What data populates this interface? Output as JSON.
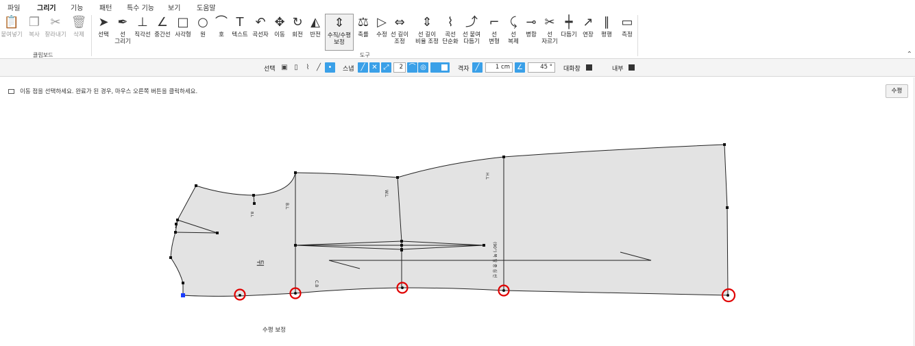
{
  "menu": {
    "items": [
      "파일",
      "그리기",
      "기능",
      "패턴",
      "특수 기능",
      "보기",
      "도움말"
    ]
  },
  "ribbon": {
    "clipboard": {
      "group_label": "클립보드",
      "buttons": [
        {
          "label": "붙여넣기",
          "icon": "paste-icon"
        },
        {
          "label": "복사",
          "icon": "copy-icon"
        },
        {
          "label": "잘라내기",
          "icon": "cut-icon"
        },
        {
          "label": "삭제",
          "icon": "delete-icon"
        }
      ]
    },
    "tools": {
      "group_label": "도구",
      "buttons": [
        {
          "label": "선택",
          "icon": "select-arrow-icon"
        },
        {
          "label": "선\n그리기",
          "icon": "pen-icon"
        },
        {
          "label": "직각선",
          "icon": "perpendicular-icon"
        },
        {
          "label": "중간선",
          "icon": "middle-line-icon"
        },
        {
          "label": "사각형",
          "icon": "rectangle-icon"
        },
        {
          "label": "원",
          "icon": "circle-icon"
        },
        {
          "label": "호",
          "icon": "arc-icon"
        },
        {
          "label": "텍스트",
          "icon": "text-icon"
        },
        {
          "label": "곡선자",
          "icon": "curve-ruler-icon"
        },
        {
          "label": "이동",
          "icon": "move-icon"
        },
        {
          "label": "회전",
          "icon": "rotate-icon"
        },
        {
          "label": "반전",
          "icon": "mirror-icon"
        },
        {
          "label": "수직/수평\n보정",
          "icon": "vertical-horizontal-icon"
        },
        {
          "label": "축률",
          "icon": "scale-icon"
        },
        {
          "label": "수정",
          "icon": "edit-icon"
        },
        {
          "label": "선 길이\n조정",
          "icon": "line-length-icon"
        },
        {
          "label": "선 길이\n비율 조정",
          "icon": "line-ratio-icon"
        },
        {
          "label": "곡선\n단순화",
          "icon": "curve-simplify-icon"
        },
        {
          "label": "선 붙여\n다듬기",
          "icon": "line-attach-icon"
        },
        {
          "label": "선\n변형",
          "icon": "line-transform-icon"
        },
        {
          "label": "선\n복제",
          "icon": "line-duplicate-icon"
        },
        {
          "label": "병합",
          "icon": "merge-icon"
        },
        {
          "label": "선\n자르기",
          "icon": "line-cut-icon"
        },
        {
          "label": "다듬기",
          "icon": "trim-icon"
        },
        {
          "label": "연장",
          "icon": "extend-icon"
        },
        {
          "label": "평행",
          "icon": "parallel-icon"
        },
        {
          "label": "측정",
          "icon": "measure-icon"
        }
      ]
    }
  },
  "options": {
    "select_label": "선택",
    "snap_label": "스냅",
    "snap_value": "2",
    "grid_label": "격자",
    "grid_value": "1 cm",
    "angle_value": "45 °",
    "dialog_label": "대화창",
    "inner_label": "내부"
  },
  "workspace": {
    "hint": "이동 점을 선택하세요. 완료가 된 경우, 마우스 오른쪽 버튼을 클릭하세요.",
    "horizontal_button": "수평",
    "caption": "수평 보정",
    "labels": {
      "bl": "B.L",
      "wl": "W.L",
      "hl": "H.L",
      "cb": "C.B",
      "front": "뒤",
      "grain": "(90°) 목 앞 중 심 선",
      "bl2": "B.L"
    },
    "colors": {
      "piece_fill": "#e3e3e3",
      "highlight": "#e00000",
      "anchor": "#1a3cff"
    }
  }
}
